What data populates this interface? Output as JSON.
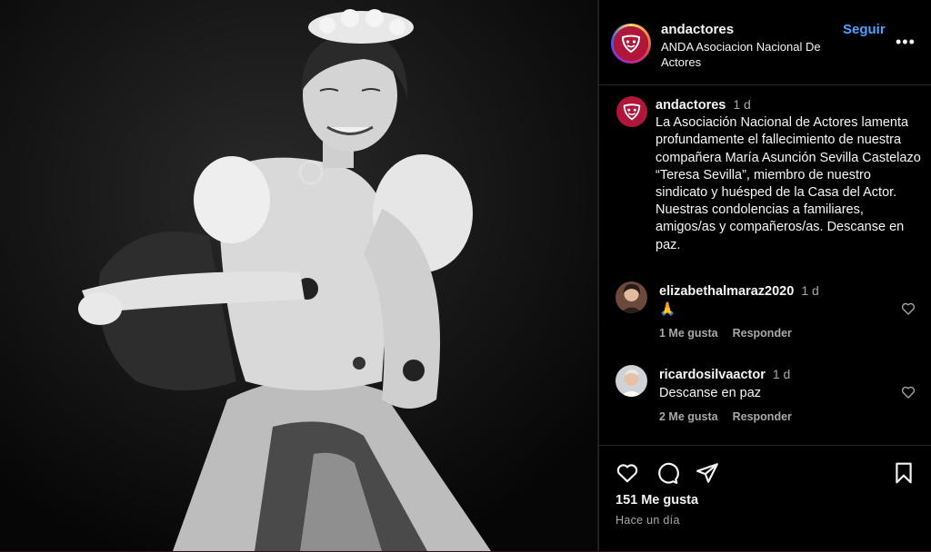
{
  "post": {
    "username": "andactores",
    "account_full_name": "ANDA Asociacion Nacional De Actores",
    "follow_label": "Seguir",
    "more_label": "•••"
  },
  "caption": {
    "username": "andactores",
    "time": "1 d",
    "text": "La Asociación Nacional de Actores lamenta profundamente el fallecimiento de nuestra compañera María Asunción Sevilla Castelazo “Teresa Sevilla”, miembro de nuestro sindicato y huésped de la Casa del Actor. Nuestras condolencias a familiares, amigos/as y compañeros/as. Descanse en paz."
  },
  "comments": [
    {
      "username": "elizabethalmaraz2020",
      "time": "1 d",
      "text": "🙏",
      "likes_label": "1 Me gusta",
      "reply_label": "Responder"
    },
    {
      "username": "ricardosilvaactor",
      "time": "1 d",
      "text": "Descanse en paz",
      "likes_label": "2 Me gusta",
      "reply_label": "Responder"
    }
  ],
  "footer": {
    "likes": "151 Me gusta",
    "timestamp": "Hace un día"
  },
  "icons": {
    "like": "heart-icon",
    "comment": "comment-bubble-icon",
    "share": "paper-plane-icon",
    "save": "bookmark-icon",
    "more": "more-dots-icon"
  },
  "colors": {
    "brand_logo": "#b0163a",
    "follow": "#4ca3ff",
    "panel_bg": "#000000",
    "secondary_text": "#a8a8a8"
  }
}
